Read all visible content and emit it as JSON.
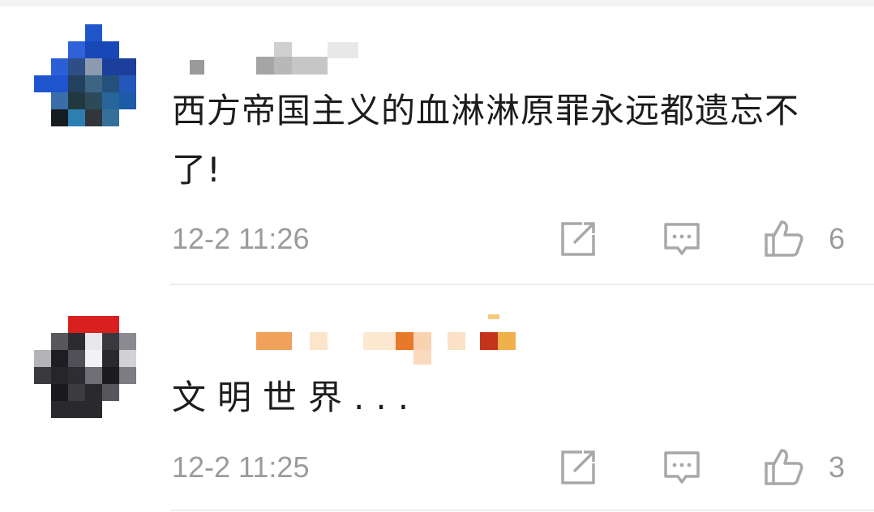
{
  "comments": [
    {
      "text": "西方帝国主义的血淋淋原罪永远都遗忘不了!",
      "timestamp": "12-2 11:26",
      "likes": "6",
      "icons": [
        "share-icon",
        "reply-icon",
        "like-icon"
      ]
    },
    {
      "text": "文明世界...",
      "timestamp": "12-2 11:25",
      "likes": "3",
      "icons": [
        "share-icon",
        "reply-icon",
        "like-icon"
      ]
    }
  ],
  "colors": {
    "meta_gray": "#9b9b9b",
    "icon_gray": "#a8a8a8",
    "text": "#1c1c1c",
    "divider": "#ececec"
  }
}
